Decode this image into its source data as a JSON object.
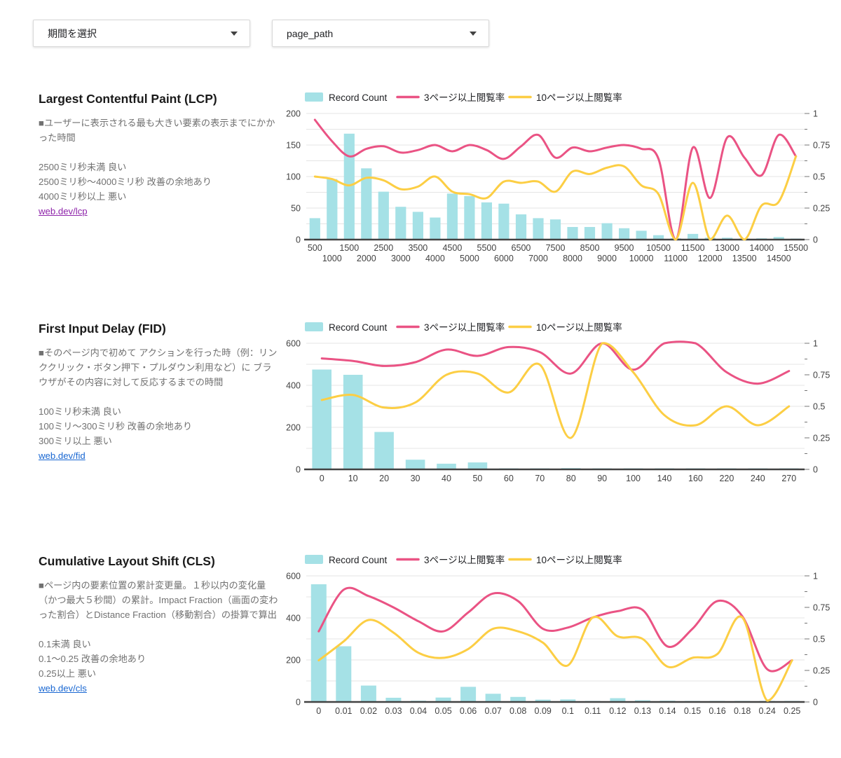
{
  "filters": [
    {
      "label": "期間を選択"
    },
    {
      "label": "page_path"
    }
  ],
  "colors": {
    "bar": "#A5E1E6",
    "line1": "#EA5384",
    "line2": "#FCCE44",
    "grid": "#E4E4E4",
    "baseline": "#424242",
    "axis_text": "#424242",
    "legend_text": "#202124",
    "tick": "#757575"
  },
  "charts": [
    {
      "title": "Largest Contentful Paint (LCP)",
      "description": "■ユーザーに表示される最も大きい要素の表示までにかかった時間",
      "thresholds": [
        "2500ミリ秒未満 良い",
        "2500ミリ秒～4000ミリ秒 改善の余地あり",
        "4000ミリ秒以上 悪い"
      ],
      "link": {
        "label": "web.dev/lcp",
        "color": "#8E24AA"
      },
      "chart_data": {
        "type": "combo",
        "legend_position": "top",
        "grid": true,
        "stagger_x_labels": true,
        "categories": [
          500,
          1000,
          1500,
          2000,
          2500,
          3000,
          3500,
          4000,
          4500,
          5000,
          5500,
          6000,
          6500,
          7000,
          7500,
          8000,
          8500,
          9000,
          9500,
          10000,
          10500,
          11000,
          11500,
          12000,
          13000,
          13500,
          14000,
          14500,
          15500
        ],
        "series": [
          {
            "name": "Record Count",
            "type": "bar",
            "axis": "left",
            "values": [
              34,
              96,
              168,
              113,
              76,
              52,
              44,
              35,
              73,
              69,
              59,
              57,
              40,
              34,
              32,
              20,
              20,
              26,
              18,
              14,
              7,
              2,
              9,
              3,
              3,
              1,
              2,
              4,
              1
            ]
          },
          {
            "name": "3ページ以上閲覧率",
            "type": "line",
            "axis": "right",
            "values": [
              0.95,
              0.78,
              0.66,
              0.72,
              0.74,
              0.69,
              0.71,
              0.75,
              0.7,
              0.75,
              0.71,
              0.64,
              0.74,
              0.83,
              0.65,
              0.73,
              0.7,
              0.73,
              0.75,
              0.72,
              0.64,
              0.0,
              0.73,
              0.33,
              0.81,
              0.65,
              0.51,
              0.83,
              0.66
            ]
          },
          {
            "name": "10ページ以上閲覧率",
            "type": "line",
            "axis": "right",
            "values": [
              0.5,
              0.48,
              0.43,
              0.49,
              0.47,
              0.4,
              0.42,
              0.5,
              0.38,
              0.36,
              0.33,
              0.46,
              0.45,
              0.46,
              0.38,
              0.54,
              0.52,
              0.57,
              0.58,
              0.43,
              0.36,
              0.0,
              0.45,
              0.0,
              0.19,
              0.0,
              0.27,
              0.3,
              0.66
            ]
          }
        ],
        "left_axis": {
          "max": 200,
          "ticks": [
            0,
            50,
            100,
            150,
            200
          ],
          "minor_step": 25
        },
        "right_axis": {
          "max": 1,
          "ticks": [
            0,
            0.25,
            0.5,
            0.75,
            1
          ]
        }
      }
    },
    {
      "title": "First Input Delay (FID)",
      "description": "■そのページ内で初めて アクションを行った時（例：リンククリック・ボタン押下・プルダウン利用など）に ブラウザがその内容に対して反応するまでの時間",
      "thresholds": [
        "100ミリ秒未満 良い",
        "100ミリ～300ミリ秒 改善の余地あり",
        "300ミリ以上 悪い"
      ],
      "link": {
        "label": "web.dev/fid",
        "color": "#1967D2"
      },
      "chart_data": {
        "type": "combo",
        "legend_position": "top",
        "grid": true,
        "stagger_x_labels": false,
        "categories": [
          0,
          10,
          20,
          30,
          40,
          50,
          60,
          70,
          80,
          90,
          100,
          140,
          160,
          220,
          240,
          270
        ],
        "series": [
          {
            "name": "Record Count",
            "type": "bar",
            "axis": "left",
            "values": [
              475,
              450,
              178,
              46,
              27,
              33,
              4,
              5,
              6,
              3,
              2,
              2,
              2,
              2,
              1,
              1
            ]
          },
          {
            "name": "3ページ以上閲覧率",
            "type": "line",
            "axis": "right",
            "values": [
              0.88,
              0.86,
              0.82,
              0.85,
              0.95,
              0.9,
              0.97,
              0.93,
              0.76,
              1.0,
              0.79,
              1.0,
              1.0,
              0.77,
              0.68,
              0.78
            ]
          },
          {
            "name": "10ページ以上閲覧率",
            "type": "line",
            "axis": "right",
            "values": [
              0.55,
              0.59,
              0.49,
              0.53,
              0.75,
              0.76,
              0.61,
              0.83,
              0.25,
              1.0,
              0.77,
              0.43,
              0.35,
              0.5,
              0.35,
              0.5
            ]
          }
        ],
        "left_axis": {
          "max": 600,
          "ticks": [
            0,
            200,
            400,
            600
          ],
          "minor_step": 100
        },
        "right_axis": {
          "max": 1,
          "ticks": [
            0,
            0.25,
            0.5,
            0.75,
            1
          ]
        }
      }
    },
    {
      "title": "Cumulative Layout Shift (CLS)",
      "description": "■ページ内の要素位置の累計変更量。１秒以内の変化量（かつ最大５秒間）の累計。Impact Fraction（画面の変わった割合）とDistance Fraction（移動割合）の掛算で算出",
      "thresholds": [
        "0.1未満 良い",
        "0.1～0.25 改善の余地あり",
        "0.25以上 悪い"
      ],
      "link": {
        "label": "web.dev/cls",
        "color": "#1967D2"
      },
      "chart_data": {
        "type": "combo",
        "legend_position": "top",
        "grid": true,
        "stagger_x_labels": false,
        "categories": [
          0,
          0.01,
          0.02,
          0.03,
          0.04,
          0.05,
          0.06,
          0.07,
          0.08,
          0.09,
          0.1,
          0.11,
          0.12,
          0.13,
          0.14,
          0.15,
          0.16,
          0.18,
          0.24,
          0.25
        ],
        "series": [
          {
            "name": "Record Count",
            "type": "bar",
            "axis": "left",
            "values": [
              560,
              265,
              78,
              20,
              6,
              21,
              72,
              39,
              24,
              11,
              12,
              4,
              18,
              8,
              6,
              3,
              4,
              2,
              3,
              2
            ]
          },
          {
            "name": "3ページ以上閲覧率",
            "type": "line",
            "axis": "right",
            "values": [
              0.56,
              0.89,
              0.84,
              0.75,
              0.64,
              0.56,
              0.71,
              0.86,
              0.8,
              0.58,
              0.59,
              0.67,
              0.72,
              0.73,
              0.44,
              0.58,
              0.8,
              0.68,
              0.26,
              0.33
            ]
          },
          {
            "name": "10ページ以上閲覧率",
            "type": "line",
            "axis": "right",
            "values": [
              0.33,
              0.48,
              0.65,
              0.55,
              0.39,
              0.35,
              0.42,
              0.58,
              0.56,
              0.47,
              0.29,
              0.67,
              0.52,
              0.5,
              0.28,
              0.35,
              0.38,
              0.67,
              0.01,
              0.33
            ]
          }
        ],
        "left_axis": {
          "max": 600,
          "ticks": [
            0,
            200,
            400,
            600
          ],
          "minor_step": 100
        },
        "right_axis": {
          "max": 1,
          "ticks": [
            0,
            0.25,
            0.5,
            0.75,
            1
          ]
        }
      }
    }
  ]
}
